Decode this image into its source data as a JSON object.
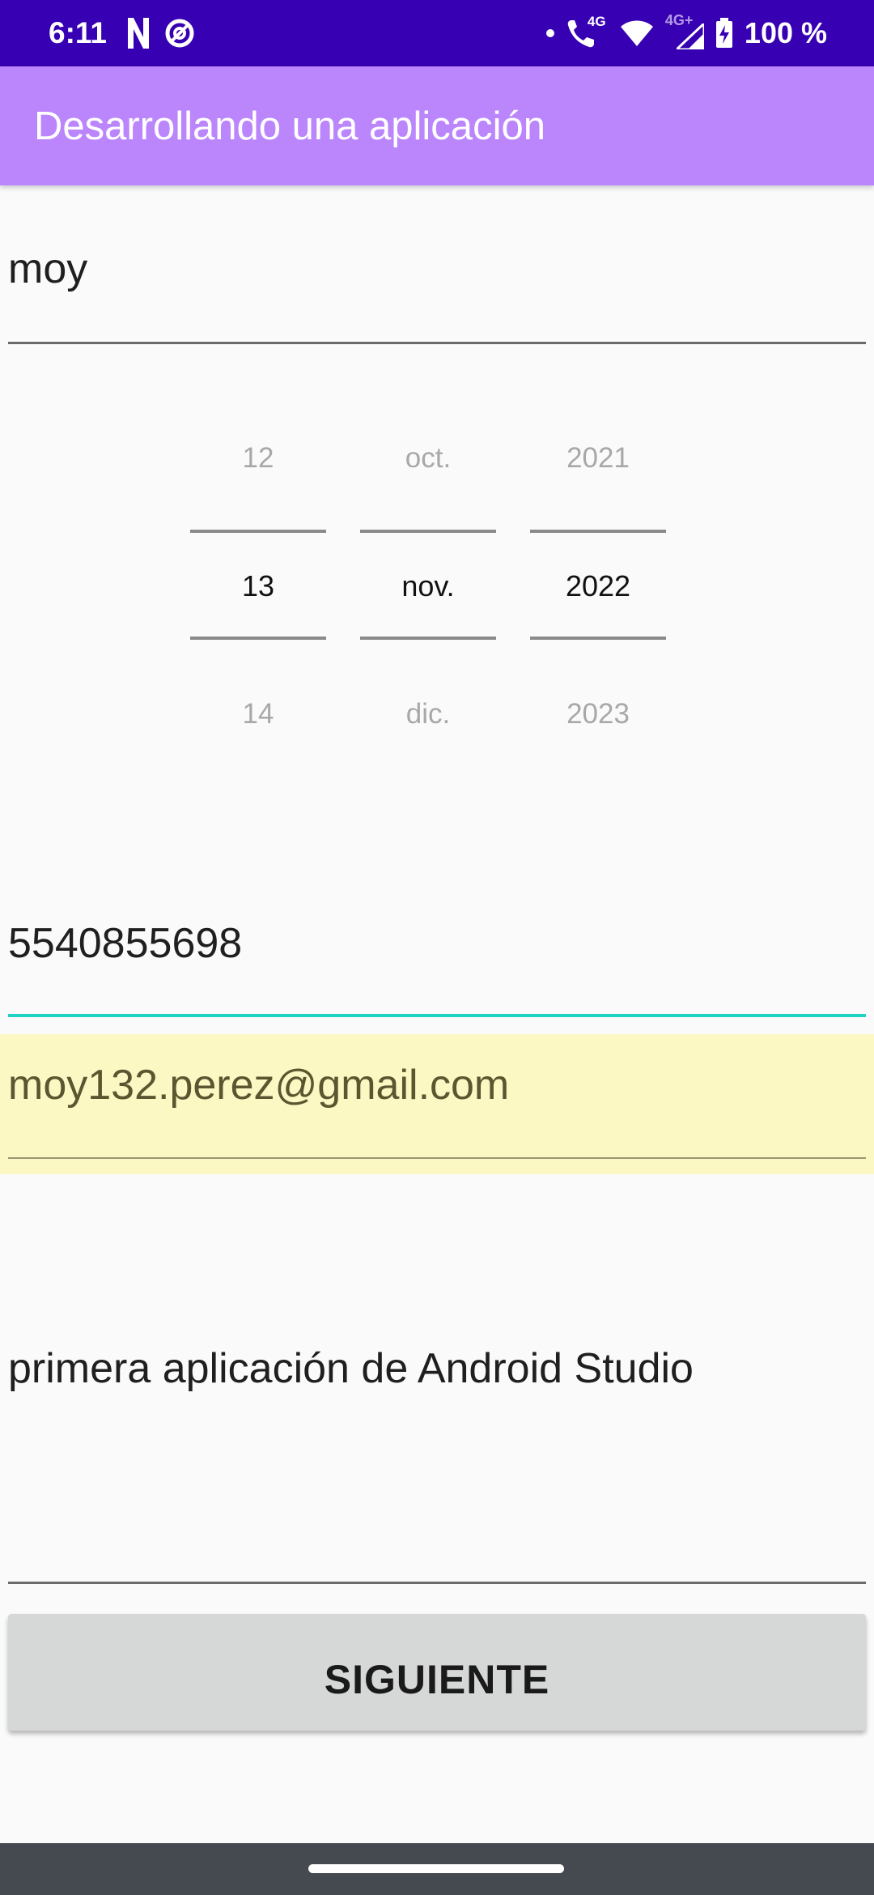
{
  "status_bar": {
    "time": "6:11",
    "battery_text": "100 %",
    "network_label": "4G",
    "network_label_2": "4G+",
    "icons": [
      "netflix-icon",
      "data-saver-icon",
      "notification-dot-icon",
      "wifi-calling-icon",
      "wifi-icon",
      "signal-icon",
      "battery-charging-icon"
    ]
  },
  "app_bar": {
    "title": "Desarrollando una aplicación"
  },
  "form": {
    "name_value": "moy",
    "date_picker": {
      "day": {
        "prev": "12",
        "selected": "13",
        "next": "14"
      },
      "month": {
        "prev": "oct.",
        "selected": "nov.",
        "next": "dic."
      },
      "year": {
        "prev": "2021",
        "selected": "2022",
        "next": "2023"
      }
    },
    "phone_value": "5540855698",
    "email_value": "moy132.perez@gmail.com",
    "description_value": "primera aplicación de Android Studio",
    "next_button_label": "SIGUIENTE"
  },
  "colors": {
    "status_bar": "#3700b3",
    "app_bar": "#bb86fc",
    "focused_underline": "#1ed3c4",
    "autofill_highlight": "#fcf8c3",
    "button": "#d6d7d7",
    "nav_bar": "#454a50"
  }
}
